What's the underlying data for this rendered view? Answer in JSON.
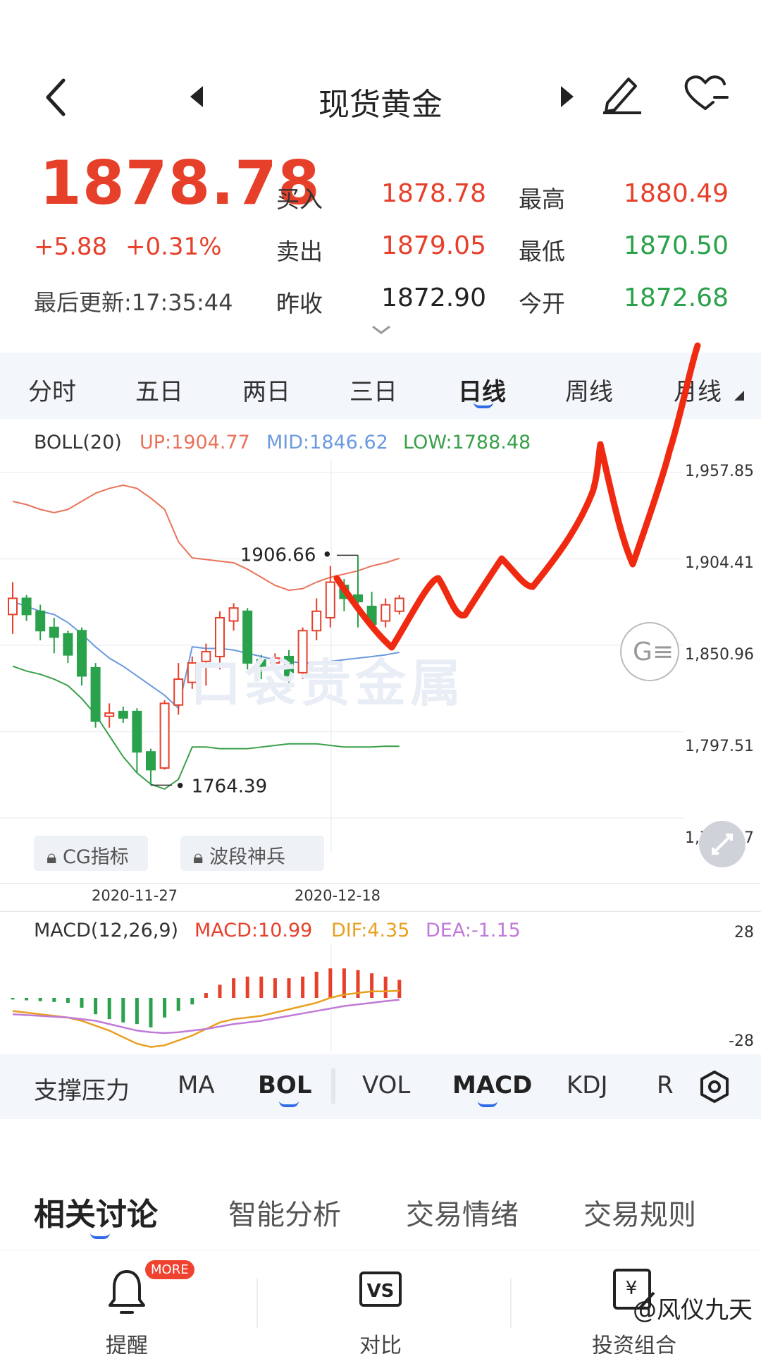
{
  "header": {
    "title": "现货黄金"
  },
  "quote": {
    "price": "1878.78",
    "change": "+5.88",
    "change_pct": "+0.31%",
    "last_update": "最后更新:17:35:44",
    "buy_label": "买入",
    "buy": "1878.78",
    "sell_label": "卖出",
    "sell": "1879.05",
    "prev_close_label": "昨收",
    "prev_close": "1872.90",
    "high_label": "最高",
    "high": "1880.49",
    "low_label": "最低",
    "low": "1870.50",
    "open_label": "今开",
    "open": "1872.68"
  },
  "period_tabs": [
    "分时",
    "五日",
    "两日",
    "三日",
    "日线",
    "周线",
    "月线"
  ],
  "period_active": "日线",
  "boll": {
    "name": "BOLL(20)",
    "up": "UP:1904.77",
    "mid": "MID:1846.62",
    "low": "LOW:1788.48"
  },
  "price_axis": [
    "1,957.85",
    "1,904.41",
    "1,850.96",
    "1,797.51",
    "1,744.07"
  ],
  "annotations": {
    "max": "1906.66",
    "min": "1764.39"
  },
  "badges": [
    "CG指标",
    "波段神兵"
  ],
  "dates": [
    "2020-11-27",
    "2020-12-18"
  ],
  "macd": {
    "name": "MACD(12,26,9)",
    "macd": "MACD:10.99",
    "dif": "DIF:4.35",
    "dea": "DEA:-1.15",
    "axis_top": "28",
    "axis_bottom": "-28"
  },
  "indicator_tabs": [
    "支撑压力",
    "MA",
    "BOL",
    "VOL",
    "MACD",
    "KDJ",
    "R"
  ],
  "indicator_active": [
    "BOL",
    "MACD"
  ],
  "discussion_tabs": [
    "相关讨论",
    "智能分析",
    "交易情绪",
    "交易规则"
  ],
  "bottom_nav": {
    "alert": "提醒",
    "alert_badge": "MORE",
    "compare": "对比",
    "portfolio": "投资组合"
  },
  "watermark": "@风仪九天",
  "colors": {
    "up": "#e6402b",
    "down": "#2aa14b",
    "boll_up": "#e8735a",
    "boll_mid": "#6b9ae0",
    "boll_low": "#3aa04a",
    "macd_dif": "#e8a020",
    "macd_dea": "#c07ad8",
    "accent": "#2f6be6"
  },
  "chart_data": {
    "type": "candlestick",
    "ylim": [
      1744.07,
      1957.85
    ],
    "candles": [
      {
        "o": 1870,
        "c": 1880,
        "h": 1890,
        "l": 1858
      },
      {
        "o": 1880,
        "c": 1870,
        "h": 1882,
        "l": 1866
      },
      {
        "o": 1872,
        "c": 1860,
        "h": 1876,
        "l": 1854
      },
      {
        "o": 1862,
        "c": 1856,
        "h": 1868,
        "l": 1846
      },
      {
        "o": 1858,
        "c": 1845,
        "h": 1860,
        "l": 1840
      },
      {
        "o": 1860,
        "c": 1832,
        "h": 1862,
        "l": 1826
      },
      {
        "o": 1837,
        "c": 1804,
        "h": 1840,
        "l": 1800
      },
      {
        "o": 1807,
        "c": 1809,
        "h": 1815,
        "l": 1800
      },
      {
        "o": 1810,
        "c": 1806,
        "h": 1813,
        "l": 1803
      },
      {
        "o": 1810,
        "c": 1785,
        "h": 1812,
        "l": 1772
      },
      {
        "o": 1785,
        "c": 1774,
        "h": 1787,
        "l": 1764.39
      },
      {
        "o": 1775,
        "c": 1815,
        "h": 1817,
        "l": 1774
      },
      {
        "o": 1814,
        "c": 1830,
        "h": 1840,
        "l": 1808
      },
      {
        "o": 1828,
        "c": 1840,
        "h": 1844,
        "l": 1824
      },
      {
        "o": 1841,
        "c": 1847,
        "h": 1852,
        "l": 1826
      },
      {
        "o": 1844,
        "c": 1868,
        "h": 1872,
        "l": 1836
      },
      {
        "o": 1866,
        "c": 1874,
        "h": 1877,
        "l": 1860
      },
      {
        "o": 1872,
        "c": 1840,
        "h": 1874,
        "l": 1836
      },
      {
        "o": 1842,
        "c": 1838,
        "h": 1845,
        "l": 1830
      },
      {
        "o": 1840,
        "c": 1843,
        "h": 1846,
        "l": 1834
      },
      {
        "o": 1844,
        "c": 1832,
        "h": 1848,
        "l": 1826
      },
      {
        "o": 1834,
        "c": 1860,
        "h": 1862,
        "l": 1830
      },
      {
        "o": 1860,
        "c": 1872,
        "h": 1880,
        "l": 1854
      },
      {
        "o": 1868,
        "c": 1890,
        "h": 1900,
        "l": 1862
      },
      {
        "o": 1888,
        "c": 1880,
        "h": 1892,
        "l": 1872
      },
      {
        "o": 1882,
        "c": 1878,
        "h": 1906.66,
        "l": 1862
      },
      {
        "o": 1875,
        "c": 1864,
        "h": 1884,
        "l": 1860
      },
      {
        "o": 1866,
        "c": 1876,
        "h": 1880,
        "l": 1862
      },
      {
        "o": 1872,
        "c": 1880,
        "h": 1882,
        "l": 1870
      }
    ],
    "boll_up": [
      1940,
      1938,
      1935,
      1933,
      1935,
      1940,
      1945,
      1948,
      1950,
      1948,
      1942,
      1935,
      1915,
      1905,
      1904,
      1903,
      1902,
      1898,
      1893,
      1888,
      1885,
      1886,
      1890,
      1893,
      1895,
      1897,
      1900,
      1902,
      1904.77
    ],
    "boll_mid": [
      1878,
      1875,
      1872,
      1870,
      1865,
      1858,
      1850,
      1843,
      1838,
      1832,
      1826,
      1820,
      1812,
      1850,
      1849,
      1849,
      1848,
      1846,
      1844,
      1842,
      1841,
      1840,
      1840,
      1841,
      1842,
      1843,
      1844,
      1845,
      1846.62
    ],
    "boll_low": [
      1838,
      1835,
      1833,
      1830,
      1826,
      1818,
      1808,
      1795,
      1782,
      1772,
      1765,
      1762,
      1768,
      1788,
      1788,
      1787,
      1787,
      1787,
      1788,
      1789,
      1790,
      1790,
      1790,
      1789,
      1788,
      1788,
      1788,
      1788.5,
      1788.48
    ],
    "macd_hist": [
      -1,
      -1.5,
      -2,
      -2.5,
      -3,
      -6,
      -10,
      -13,
      -15,
      -16,
      -18,
      -12,
      -8,
      -4,
      3,
      8,
      12,
      13,
      13,
      12,
      12,
      13,
      16,
      18,
      18,
      17,
      15,
      13,
      11
    ],
    "macd_dif": [
      -8,
      -9,
      -10,
      -11,
      -12,
      -14,
      -17,
      -20,
      -24,
      -28,
      -30,
      -29,
      -26,
      -23,
      -19,
      -15,
      -13,
      -12,
      -11,
      -9,
      -7,
      -5,
      -3,
      0,
      2,
      3,
      4,
      4,
      4.35
    ],
    "macd_dea": [
      -10,
      -10.5,
      -11,
      -11.5,
      -12,
      -13,
      -14,
      -16,
      -18,
      -20,
      -21,
      -21.5,
      -21,
      -20,
      -19,
      -17.5,
      -16,
      -15,
      -14,
      -12.5,
      -11,
      -9.5,
      -8,
      -6.5,
      -5,
      -4,
      -3,
      -2,
      -1.15
    ],
    "macd_ylim": [
      -28,
      28
    ]
  }
}
